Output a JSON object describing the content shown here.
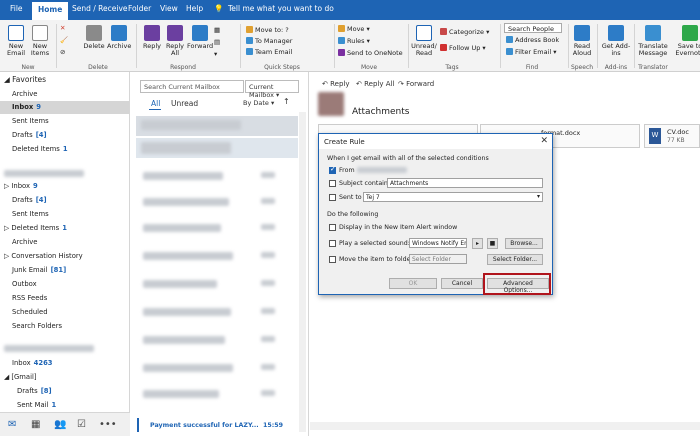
{
  "tabs": [
    "File",
    "Home",
    "Send / Receive",
    "Folder",
    "View",
    "Help"
  ],
  "tell_me": "Tell me what you want to do",
  "ribbon": {
    "new_email": "New Email",
    "new_items": "New Items",
    "delete": "Delete",
    "archive": "Archive",
    "reply": "Reply",
    "reply_all": "Reply All",
    "forward": "Forward",
    "quick_steps": [
      "Move to: ?",
      "To Manager",
      "Team Email"
    ],
    "move": "Move",
    "rules": "Rules",
    "send_to_onenote": "Send to OneNote",
    "unread_read": "Unread/ Read",
    "categorize": "Categorize",
    "follow_up": "Follow Up",
    "search_people": "Search People",
    "address_book": "Address Book",
    "filter_email": "Filter Email",
    "read_aloud": "Read Aloud",
    "get_addins": "Get Add-ins",
    "translate_message": "Translate Message",
    "save_to_evernote": "Save to Evernote",
    "groups": [
      "New",
      "Delete",
      "Respond",
      "Quick Steps",
      "Move",
      "Tags",
      "Find",
      "Speech",
      "Add-ins",
      "Translator"
    ]
  },
  "folders": {
    "favorites": "Favorites",
    "fav_items": [
      {
        "label": "Archive",
        "count": ""
      },
      {
        "label": "Inbox",
        "count": "9"
      },
      {
        "label": "Sent Items",
        "count": ""
      },
      {
        "label": "Drafts",
        "count": "[4]"
      },
      {
        "label": "Deleted Items",
        "count": "1"
      }
    ],
    "acct_items": [
      {
        "label": "Inbox",
        "count": "9"
      },
      {
        "label": "Drafts",
        "count": "[4]"
      },
      {
        "label": "Sent Items",
        "count": ""
      },
      {
        "label": "Deleted Items",
        "count": "1"
      },
      {
        "label": "Archive",
        "count": ""
      },
      {
        "label": "Conversation History",
        "count": ""
      },
      {
        "label": "Junk Email",
        "count": "[81]"
      },
      {
        "label": "Outbox",
        "count": ""
      },
      {
        "label": "RSS Feeds",
        "count": ""
      },
      {
        "label": "Scheduled",
        "count": ""
      },
      {
        "label": "Search Folders",
        "count": ""
      }
    ],
    "second_inbox": {
      "label": "Inbox",
      "count": "4263"
    },
    "gmail": "[Gmail]",
    "gmail_items": [
      {
        "label": "Drafts",
        "count": "[8]"
      },
      {
        "label": "Sent Mail",
        "count": "1"
      }
    ]
  },
  "list": {
    "search_placeholder": "Search Current Mailbox",
    "scope": "Current Mailbox",
    "filter_all": "All",
    "filter_unread": "Unread",
    "sort": "By Date",
    "last_subject": "Payment successful for LAZY...",
    "last_time": "15:59"
  },
  "reading": {
    "reply": "Reply",
    "reply_all": "Reply All",
    "forward": "Forward",
    "subject": "Attachments",
    "attachment_1": "format.docx",
    "attachment_2": "CV.doc",
    "attachment_2_size": "77 KB"
  },
  "dialog": {
    "title": "Create Rule",
    "conditions_heading": "When I get email with all of the selected conditions",
    "from_label": "From",
    "subject_label": "Subject contains",
    "subject_value": "Attachments",
    "sent_to_label": "Sent to",
    "sent_to_value": "Tej 7",
    "do_following": "Do the following",
    "display_alert": "Display in the New Item Alert window",
    "play_sound": "Play a selected sound:",
    "sound_value": "Windows Notify Emai",
    "browse": "Browse...",
    "move_to_folder": "Move the item to folder:",
    "select_folder_placeholder": "Select Folder",
    "select_folder_btn": "Select Folder...",
    "ok": "OK",
    "cancel": "Cancel",
    "advanced": "Advanced Options..."
  }
}
